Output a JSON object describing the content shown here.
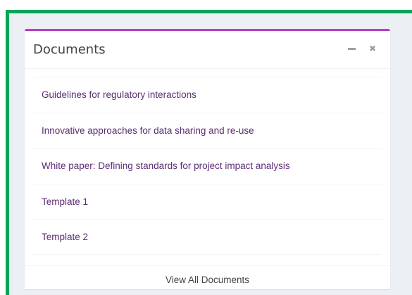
{
  "box": {
    "title": "Documents",
    "tools": {
      "collapse_icon": "minus-icon",
      "close_icon": "close-icon",
      "close_glyph": "✖"
    },
    "accent_color": "#b83ec2",
    "frame_color": "#00a65a",
    "link_color": "#5b2d72"
  },
  "documents": [
    {
      "label": "Guidelines for regulatory interactions"
    },
    {
      "label": "Innovative approaches for data sharing and re-use"
    },
    {
      "label": "White paper: Defining standards for project impact analysis"
    },
    {
      "label": "Template 1"
    },
    {
      "label": "Template 2"
    }
  ],
  "footer": {
    "view_all_label": "View All Documents"
  }
}
